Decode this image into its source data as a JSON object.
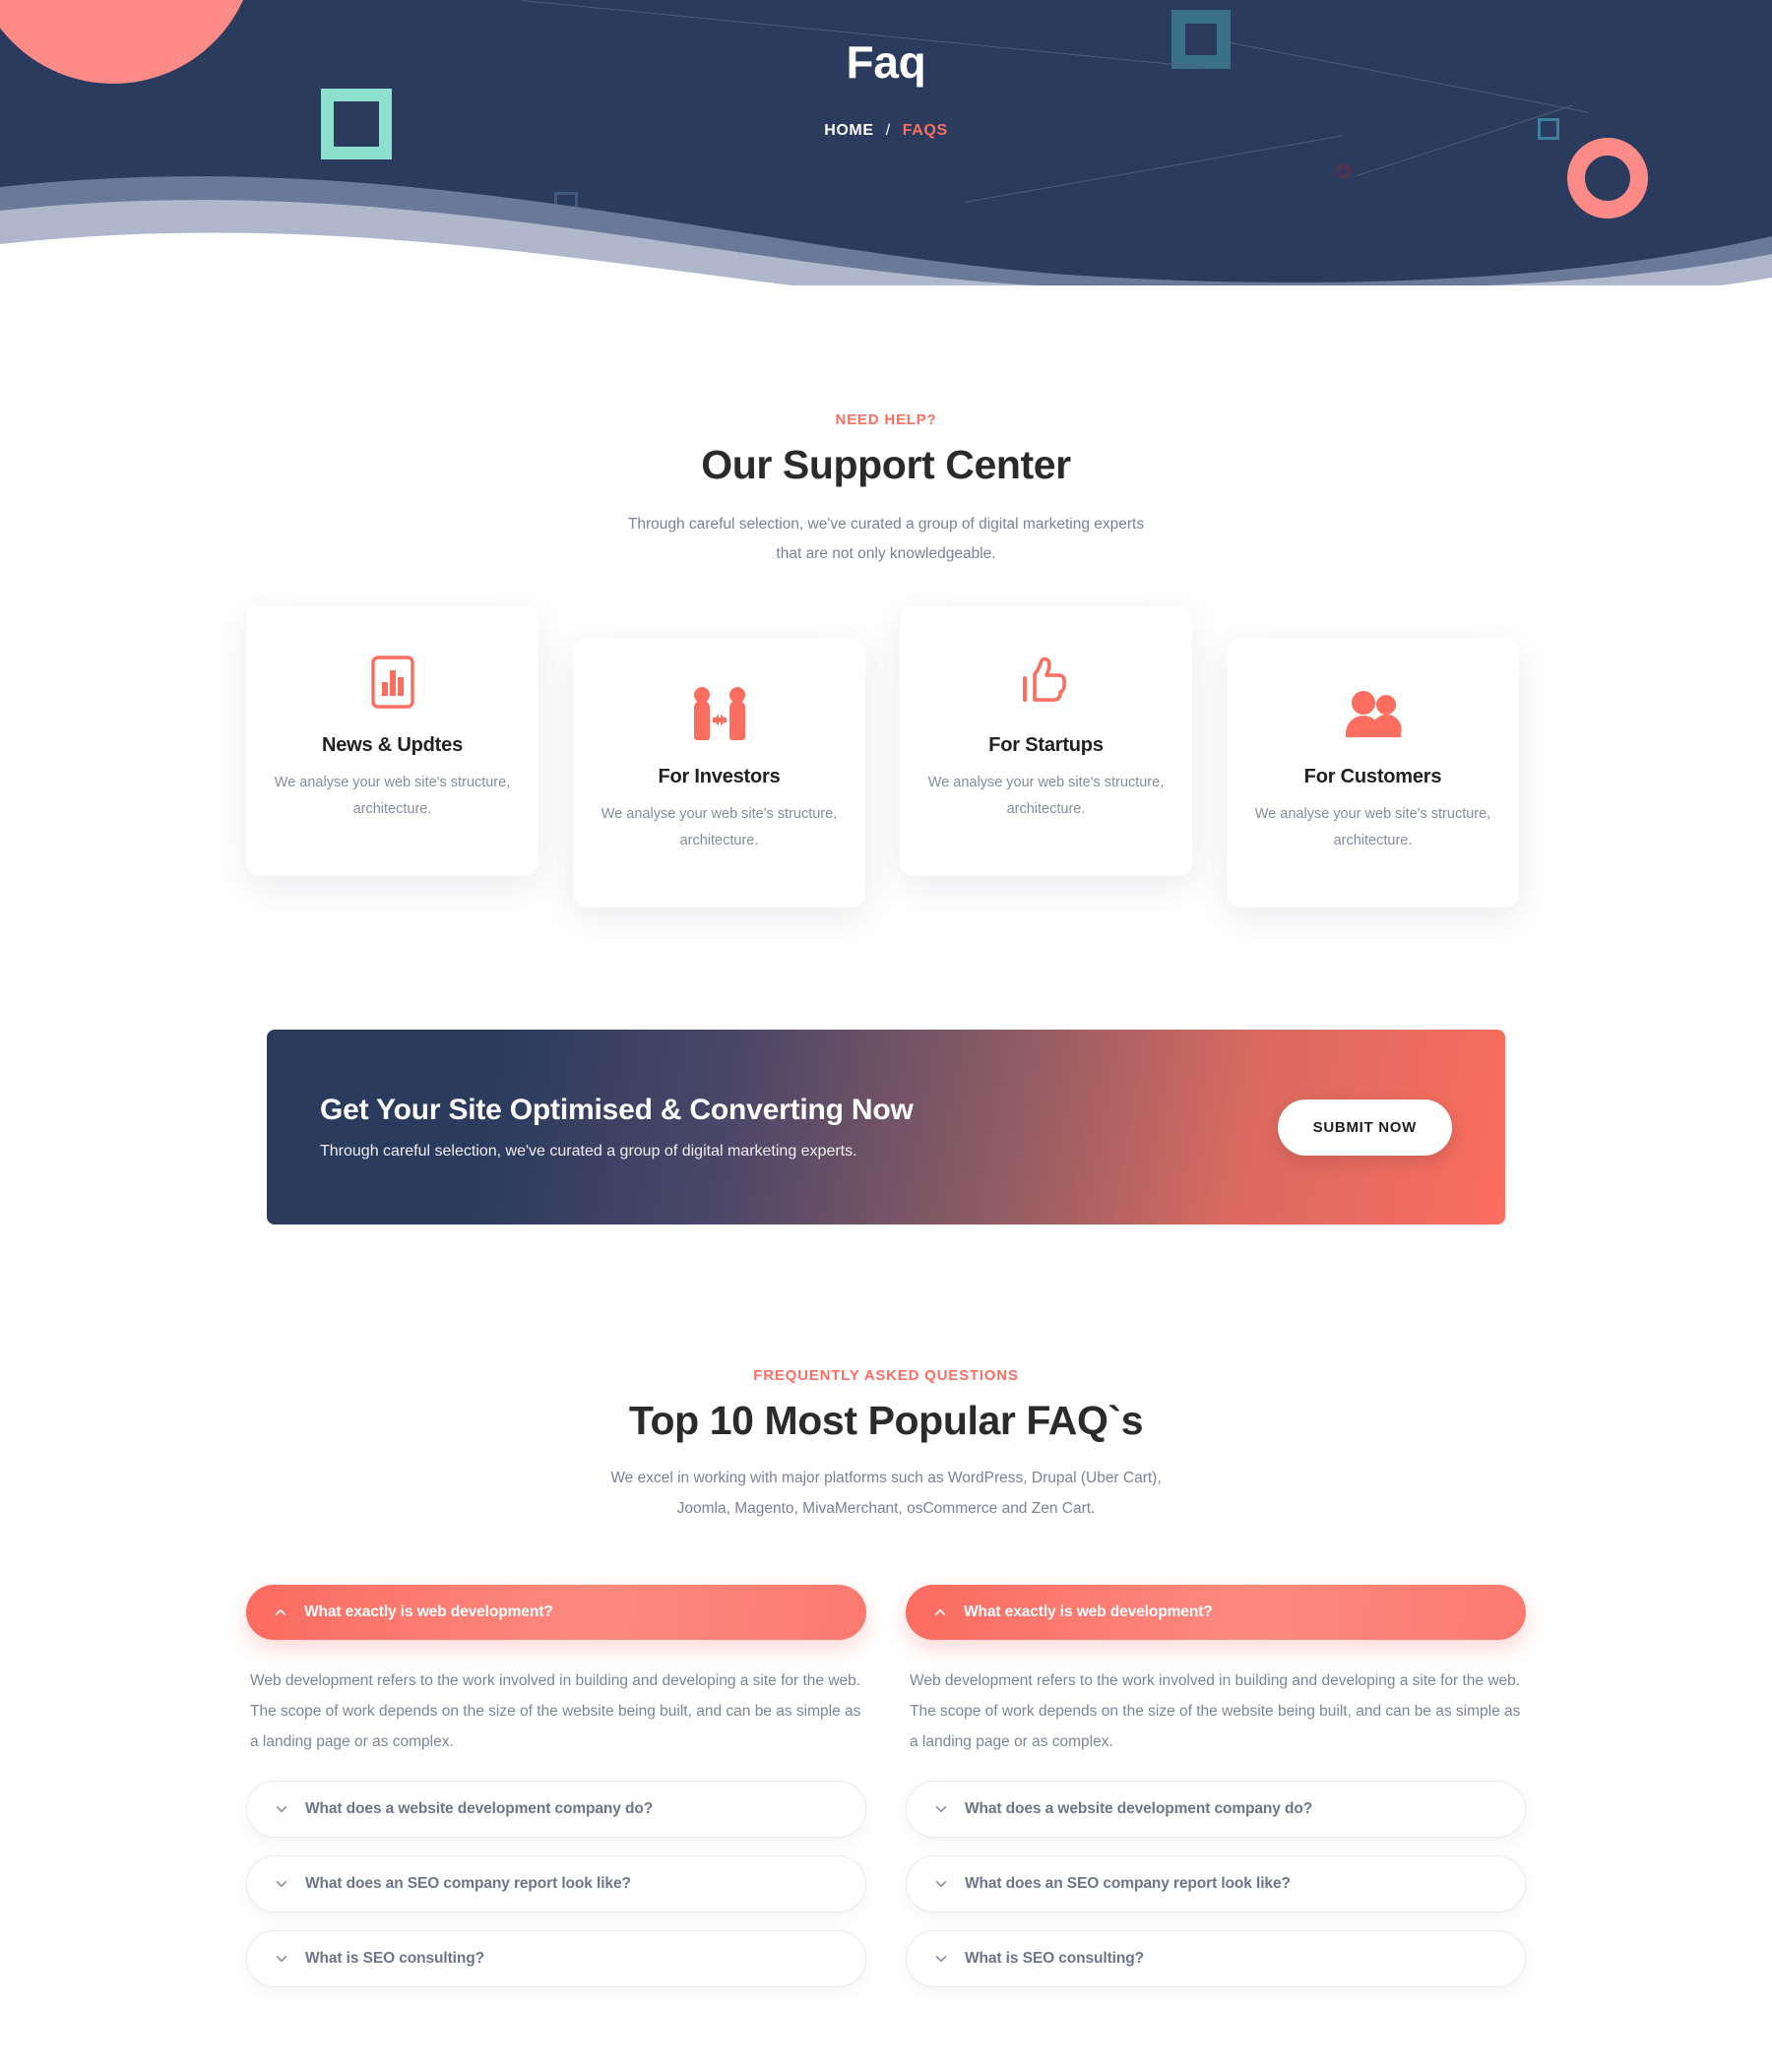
{
  "hero": {
    "title": "Faq",
    "breadcrumb": {
      "home": "HOME",
      "separator": "/",
      "current": "FAQS"
    },
    "colors": {
      "background": "#2a3b5e",
      "accent": "#fc6d63",
      "mint": "#8ce0cd",
      "teal": "#3a7189",
      "salmon": "#fc8b88"
    }
  },
  "support": {
    "eyebrow": "NEED HELP?",
    "title": "Our Support Center",
    "subtitle": "Through careful selection, we've curated a group of digital marketing experts that are not only knowledgeable.",
    "cards": [
      {
        "icon": "bar-chart-report-icon",
        "title": "News & Updtes",
        "desc": "We analyse your web site's structure, architecture."
      },
      {
        "icon": "handshake-deal-icon",
        "title": "For Investors",
        "desc": "We analyse your web site's structure, architecture."
      },
      {
        "icon": "thumbs-up-icon",
        "title": "For Startups",
        "desc": "We analyse your web site's structure, architecture."
      },
      {
        "icon": "users-group-icon",
        "title": "For Customers",
        "desc": "We analyse your web site's structure, architecture."
      }
    ]
  },
  "cta": {
    "title": "Get Your Site Optimised & Converting Now",
    "subtitle": "Through careful selection, we've curated a group of digital marketing experts.",
    "button_label": "SUBMIT NOW",
    "gradient_from": "#2a3b5e",
    "gradient_to": "#fb6d5f"
  },
  "faq": {
    "eyebrow": "FREQUENTLY ASKED QUESTIONS",
    "title": "Top 10 Most Popular FAQ`s",
    "subtitle": "We excel in working with major platforms such as WordPress, Drupal (Uber Cart), Joomla, Magento, MivaMerchant, osCommerce and Zen Cart.",
    "answer_text": "Web development refers to the work involved in building and developing a site for the web. The scope of work depends on the size of the website being built, and can be as simple as a landing page or as complex.",
    "left_column": [
      {
        "question": "What exactly is web development?",
        "open": true,
        "icon": "chevron-up-icon"
      },
      {
        "question": "What does a website development company do?",
        "open": false,
        "icon": "chevron-down-icon"
      },
      {
        "question": "What does an SEO company report look like?",
        "open": false,
        "icon": "chevron-down-icon"
      },
      {
        "question": "What is SEO consulting?",
        "open": false,
        "icon": "chevron-down-icon"
      }
    ],
    "right_column": [
      {
        "question": "What exactly is web development?",
        "open": true,
        "icon": "chevron-up-icon"
      },
      {
        "question": "What does a website development company do?",
        "open": false,
        "icon": "chevron-down-icon"
      },
      {
        "question": "What does an SEO company report look like?",
        "open": false,
        "icon": "chevron-down-icon"
      },
      {
        "question": "What is SEO consulting?",
        "open": false,
        "icon": "chevron-down-icon"
      }
    ]
  }
}
